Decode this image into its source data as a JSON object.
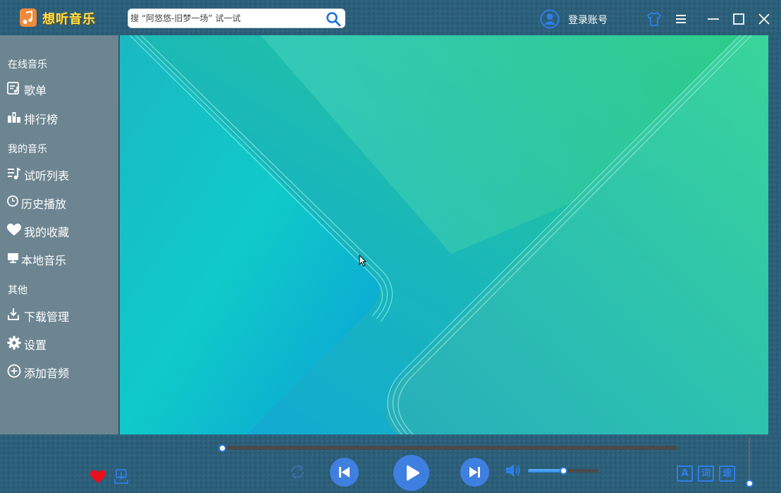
{
  "app": {
    "title": "想听音乐",
    "brand_color": "#ffe34d",
    "logo_icon": "music-note-icon"
  },
  "search": {
    "placeholder": "搜 “阿悠悠-旧梦一场” 试一试",
    "icon": "search-icon"
  },
  "header": {
    "login_label": "登录账号",
    "icons": [
      "user-icon",
      "skin-shirt-icon",
      "menu-icon",
      "minimize-icon",
      "maximize-icon",
      "close-icon"
    ]
  },
  "sidebar": {
    "sections": [
      {
        "title": "在线音乐",
        "items": [
          {
            "label": "歌单",
            "icon": "playlist-icon"
          },
          {
            "label": "排行榜",
            "icon": "ranking-icon"
          }
        ]
      },
      {
        "title": "我的音乐",
        "items": [
          {
            "label": "试听列表",
            "icon": "music-list-icon"
          },
          {
            "label": "历史播放",
            "icon": "clock-icon"
          },
          {
            "label": "我的收藏",
            "icon": "heart-icon"
          },
          {
            "label": "本地音乐",
            "icon": "monitor-icon"
          }
        ]
      },
      {
        "title": "其他",
        "items": [
          {
            "label": "下载管理",
            "icon": "download-icon"
          },
          {
            "label": "设置",
            "icon": "gear-icon"
          },
          {
            "label": "添加音频",
            "icon": "add-circle-icon"
          }
        ]
      }
    ]
  },
  "player": {
    "progress": 0,
    "volume": 0.5,
    "accent_color": "#3f7fe0",
    "favorite_color": "#e8101e",
    "lyric_buttons": [
      "A",
      "词",
      "速"
    ],
    "icons": [
      "favorite-heart-icon",
      "download-song-icon",
      "loop-icon",
      "previous-icon",
      "play-icon",
      "next-icon",
      "volume-icon"
    ]
  }
}
